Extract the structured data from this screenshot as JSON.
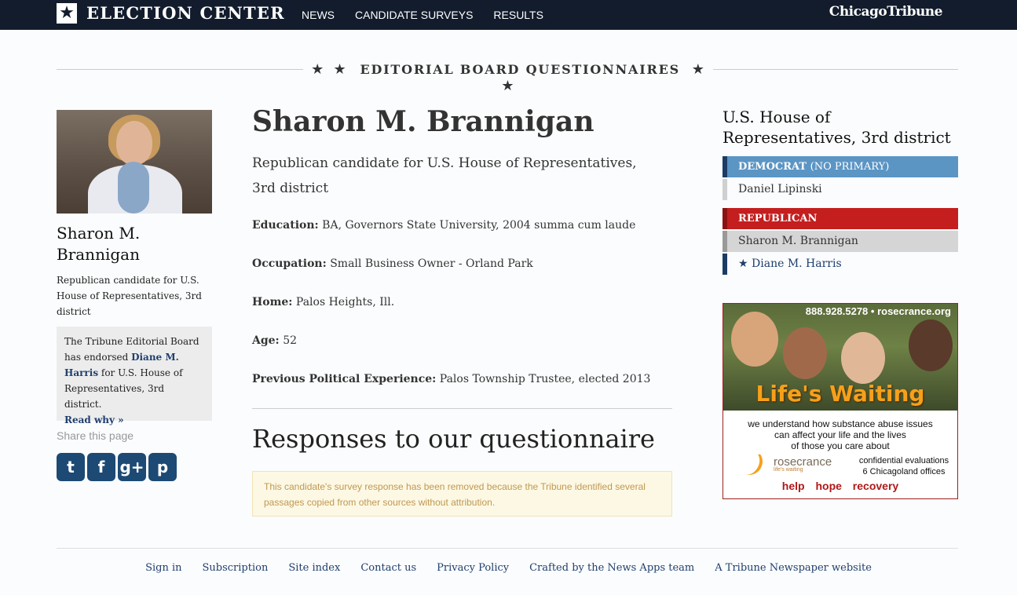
{
  "header": {
    "brand": "ELECTION CENTER",
    "nav": [
      "NEWS",
      "CANDIDATE SURVEYS",
      "RESULTS"
    ],
    "publisher_logo": "ChicagoTribune"
  },
  "section": {
    "stars_left": "★ ★",
    "title": "EDITORIAL BOARD QUESTIONNAIRES",
    "stars_right": "★ ★"
  },
  "sidebar": {
    "name": "Sharon M. Brannigan",
    "description": "Republican candidate for U.S. House of Representatives, 3rd district",
    "endorsement": {
      "prefix": "The Tribune Editorial Board has endorsed ",
      "endorsee": "Diane M. Harris",
      "suffix": " for U.S. House of Representatives, 3rd district.",
      "read_why": "Read why »"
    },
    "share_label": "Share this page",
    "social": [
      {
        "icon": "twitter-icon",
        "glyph": "t"
      },
      {
        "icon": "facebook-icon",
        "glyph": "f"
      },
      {
        "icon": "googleplus-icon",
        "glyph": "g+"
      },
      {
        "icon": "pinterest-icon",
        "glyph": "p"
      }
    ]
  },
  "candidate": {
    "name": "Sharon M. Brannigan",
    "description": "Republican candidate for U.S. House of Representatives, 3rd district",
    "fields": [
      {
        "label": "Education:",
        "value": "BA, Governors State University, 2004 summa cum laude"
      },
      {
        "label": "Occupation:",
        "value": "Small Business Owner - Orland Park"
      },
      {
        "label": "Home:",
        "value": "Palos Heights, Ill."
      },
      {
        "label": "Age:",
        "value": "52"
      },
      {
        "label": "Previous Political Experience:",
        "value": "Palos Township Trustee, elected 2013"
      }
    ],
    "responses_title": "Responses to our questionnaire",
    "notice": "This candidate's survey response has been removed because the Tribune identified several passages copied from other sources without attribution."
  },
  "race": {
    "title": "U.S. House of Representatives, 3rd district",
    "democrat_label": "DEMOCRAT",
    "democrat_note": "(NO PRIMARY)",
    "democrat_candidates": [
      "Daniel Lipinski"
    ],
    "republican_label": "REPUBLICAN",
    "republican_candidates": [
      "Sharon M. Brannigan",
      "Diane M. Harris"
    ],
    "endorsed_star": "★"
  },
  "ad": {
    "phone": "888.928.5278 • rosecrance.org",
    "headline": "Life's Waiting",
    "body_1": "we understand how substance abuse issues",
    "body_2": "can affect your life and the lives",
    "body_3": "of those you care about",
    "logo": "rosecrance",
    "logo_tag": "life's waiting",
    "conf_1": "confidential evaluations",
    "conf_2": "6 Chicagoland offices",
    "tagline": "help hope recovery"
  },
  "footer": [
    "Sign in",
    "Subscription",
    "Site index",
    "Contact us",
    "Privacy Policy",
    "Crafted by the News Apps team",
    "A Tribune Newspaper website"
  ],
  "colors": {
    "nav_bg": "#121c2c",
    "democrat": "#5b95c4",
    "republican": "#c41e1e",
    "link": "#1f3f6e"
  }
}
